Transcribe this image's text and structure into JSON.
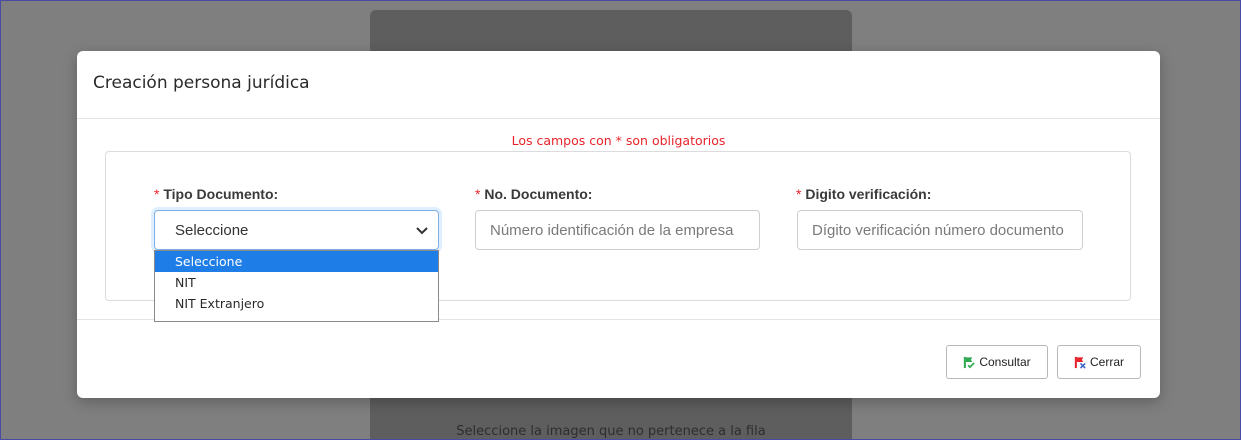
{
  "background": {
    "caption": "Seleccione la imagen que no pertenece a la fila"
  },
  "modal": {
    "title": "Creación persona jurídica",
    "required_note": "Los campos con * son obligatorios",
    "fields": {
      "tipo_documento": {
        "star": "*",
        "label": "Tipo Documento:",
        "value": "Seleccione",
        "options": [
          "Seleccione",
          "NIT",
          "NIT Extranjero"
        ]
      },
      "no_documento": {
        "star": "*",
        "label": "No. Documento:",
        "value": "",
        "placeholder": "Número identificación de la empresa"
      },
      "digito_verificacion": {
        "star": "*",
        "label": "Digito verificación:",
        "value": "",
        "placeholder": "Dígito verificación número documento"
      }
    },
    "buttons": {
      "consultar": "Consultar",
      "cerrar": "Cerrar"
    }
  },
  "colors": {
    "required": "#e8232b",
    "selected_option": "#1e7de6",
    "consultar_icon": "#2fa84f",
    "cerrar_icon": "#e8232b"
  },
  "icons": {
    "select_arrow": "chevron-down-icon",
    "consultar": "flag-check-icon",
    "cerrar": "flag-x-icon"
  }
}
